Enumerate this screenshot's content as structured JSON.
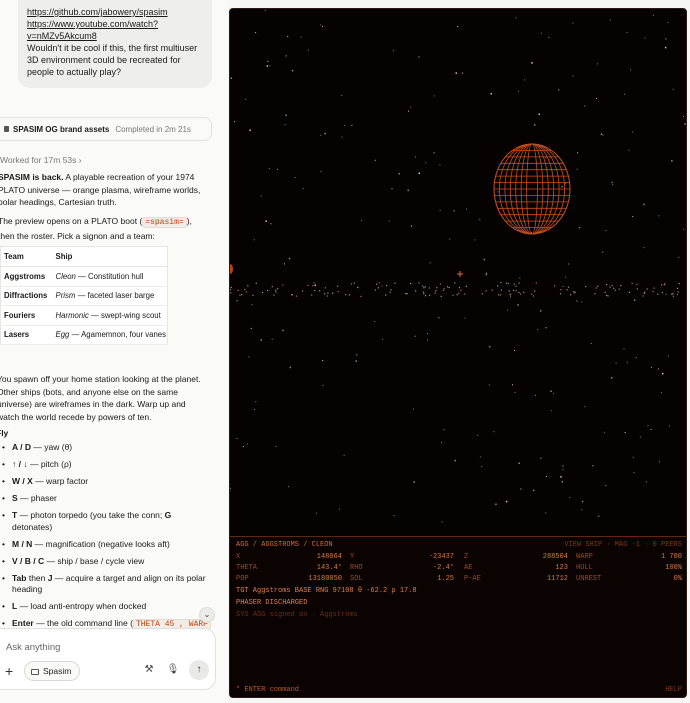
{
  "chat": {
    "user_message": {
      "line1": "https://github.com/jabowery/spasim",
      "line2": "https://www.youtube.com/watch?",
      "line3": "v=nMZv5Akcum8",
      "line4": "Wouldn't it be cool if this, the first multiuser",
      "line5": "3D environment could be recreated for",
      "line6": "people to actually play?"
    },
    "artifact": {
      "title": "SPASIM OG brand assets",
      "status": "Completed in 2m 21s"
    },
    "worked": "Worked for 17m 53s",
    "intro": {
      "bold": "SPASIM is back.",
      "rest": " A playable recreation of your 1974 PLATO universe — orange plasma, wireframe worlds, polar headings, Cartesian truth."
    },
    "preview": {
      "before": "The preview opens on a PLATO boot (",
      "code": "=spasim=",
      "after": "), then the roster. Pick a signon and a team:"
    },
    "table": {
      "headers": [
        "Team",
        "Ship"
      ],
      "rows": [
        {
          "team": "Aggstroms",
          "ship": "Cleon",
          "desc": " — Constitution hull"
        },
        {
          "team": "Diffractions",
          "ship": "Prism",
          "desc": " — faceted laser barge"
        },
        {
          "team": "Fouriers",
          "ship": "Harmonic",
          "desc": " — swept-wing scout"
        },
        {
          "team": "Lasers",
          "ship": "Egg",
          "desc": " — Agamemnon, four vanes"
        }
      ]
    },
    "spawn_text": "You spawn off your home station looking at the planet. Other ships (bots, and anyone else on the same universe) are wireframes in the dark. Warp up and watch the world recede by powers of ten.",
    "fly_heading": "Fly",
    "keys": [
      {
        "key": "A / D",
        "desc": " — yaw (θ)"
      },
      {
        "key": "↑ / ↓",
        "desc": " — pitch (ρ)"
      },
      {
        "key": "W / X",
        "desc": " — warp factor"
      },
      {
        "key": "S",
        "desc": " — phaser"
      },
      {
        "key": "T",
        "desc": " — photon torpedo (you take the conn; ",
        "key2": "G",
        "desc2": " detonates)"
      },
      {
        "key": "M / N",
        "desc": " — magnification (negative looks aft)"
      },
      {
        "key": "V / B / C",
        "desc": " — ship / base / cycle view"
      },
      {
        "key": "Tab",
        "desc": " then ",
        "key2": "J",
        "desc2": " — acquire a target and align on its polar heading"
      },
      {
        "key": "L",
        "desc": " — load anti-entropy when docked"
      },
      {
        "key": "Enter",
        "desc": " — the old command line (",
        "code": "THETA 45 , WARP"
      }
    ],
    "composer": {
      "placeholder": "Ask anything",
      "project": "Spasim"
    }
  },
  "game": {
    "accent_color": "#c2410c",
    "planet_color": "#c8501e",
    "hud": {
      "title": "AGG / AGGSTROMS / CLEON",
      "status": "VIEW SHIP · MAG -1 · 0 PEERS",
      "rows": [
        [
          [
            "X",
            "148064"
          ],
          [
            "Y",
            "-23437"
          ],
          [
            "Z",
            "288504"
          ],
          [
            "WARP",
            "1 700"
          ]
        ],
        [
          [
            "THETA",
            "143.4°"
          ],
          [
            "RHO",
            "-2.4°"
          ],
          [
            "AE",
            "123"
          ],
          [
            "HULL",
            "100%"
          ]
        ],
        [
          [
            "POP",
            "13180050"
          ],
          [
            "SOL",
            "1.25"
          ],
          [
            "P-AE",
            "11712"
          ],
          [
            "UNREST",
            "0%"
          ]
        ]
      ],
      "target_line": "TGT Aggstroms BASE RNG 97108 θ -62.2 ρ 17.8",
      "event_line": "PHASER DISCHARGED",
      "sys_line": "SYS  AGG signed on · Aggstroms",
      "command_prompt": "* ENTER command",
      "help": "HELP"
    }
  }
}
